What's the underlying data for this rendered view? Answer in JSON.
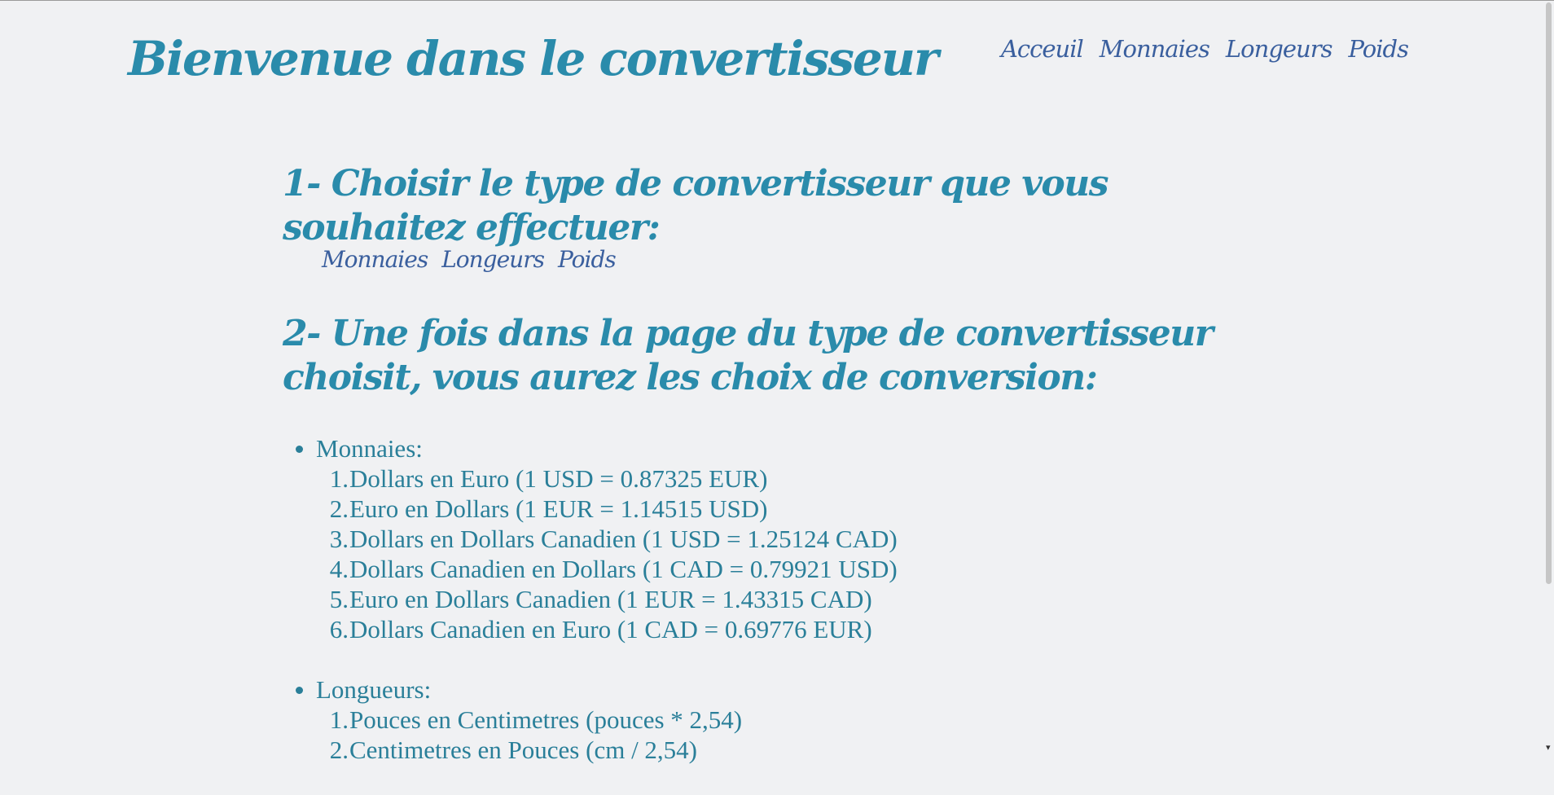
{
  "header": {
    "title": "Bienvenue dans le convertisseur",
    "nav": [
      "Acceuil",
      "Monnaies",
      "Longeurs",
      "Poids"
    ]
  },
  "step1": {
    "heading": "1- Choisir le type de convertisseur que vous souhaitez effectuer:",
    "links": [
      "Monnaies",
      "Longeurs",
      "Poids"
    ]
  },
  "step2": {
    "heading": "2- Une fois dans la page du type de convertisseur choisit, vous aurez les choix de conversion:"
  },
  "categories": [
    {
      "label": "Monnaies:",
      "items": [
        {
          "num": "1.",
          "text": "Dollars en Euro (1 USD = 0.87325 EUR)"
        },
        {
          "num": "2.",
          "text": "Euro en Dollars (1 EUR = 1.14515 USD)"
        },
        {
          "num": "3.",
          "text": "Dollars en Dollars Canadien (1 USD = 1.25124 CAD)"
        },
        {
          "num": "4.",
          "text": "Dollars Canadien en Dollars (1 CAD = 0.79921 USD)"
        },
        {
          "num": "5.",
          "text": "Euro en Dollars Canadien (1 EUR = 1.43315 CAD)"
        },
        {
          "num": "6.",
          "text": "Dollars Canadien en Euro (1 CAD = 0.69776 EUR)"
        }
      ]
    },
    {
      "label": "Longueurs:",
      "items": [
        {
          "num": "1.",
          "text": "Pouces en Centimetres (pouces * 2,54)"
        },
        {
          "num": "2.",
          "text": "Centimetres en Pouces (cm / 2,54)"
        }
      ]
    }
  ],
  "colors": {
    "background": "#f0f1f3",
    "heading": "#2a8bab",
    "nav": "#3a5f9e",
    "text": "#2a7f99"
  },
  "icons": {
    "scroll_down": "chevron-down-icon"
  }
}
